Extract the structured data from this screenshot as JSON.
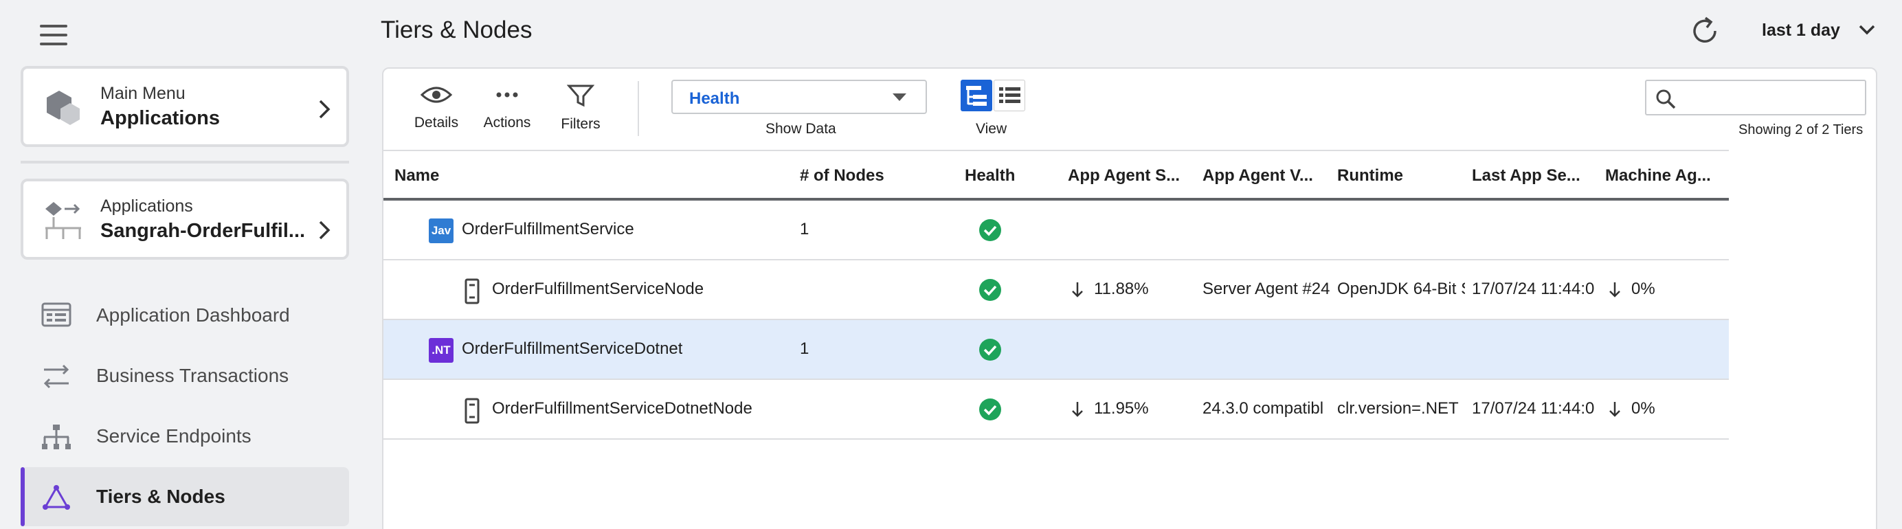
{
  "sidebar": {
    "main_menu": {
      "small": "Main Menu",
      "big": "Applications"
    },
    "application": {
      "small": "Applications",
      "big": "Sangrah-OrderFulfil..."
    },
    "nav": [
      {
        "label": "Application Dashboard",
        "icon": "dashboard-icon"
      },
      {
        "label": "Business Transactions",
        "icon": "transactions-icon"
      },
      {
        "label": "Service Endpoints",
        "icon": "endpoints-icon"
      },
      {
        "label": "Tiers & Nodes",
        "icon": "tiers-nodes-icon",
        "active": true
      }
    ]
  },
  "header": {
    "title": "Tiers & Nodes",
    "time_range": "last 1 day"
  },
  "toolbar": {
    "details": "Details",
    "actions": "Actions",
    "filters": "Filters",
    "show_data_value": "Health",
    "show_data_label": "Show Data",
    "view_label": "View",
    "search_placeholder": "",
    "showing": "Showing 2 of 2 Tiers"
  },
  "table": {
    "columns": [
      "Name",
      "# of Nodes",
      "Health",
      "App Agent S...",
      "App Agent V...",
      "Runtime",
      "Last App Se...",
      "Machine Ag..."
    ],
    "rows": [
      {
        "kind": "tier",
        "badge": "Jav",
        "name": "OrderFulfillmentService",
        "nodes": "1",
        "health": "ok",
        "agent_status": "",
        "agent_version": "",
        "runtime": "",
        "last_seen": "",
        "machine": ""
      },
      {
        "kind": "node",
        "name": "OrderFulfillmentServiceNode",
        "nodes": "",
        "health": "ok",
        "agent_status": "11.88%",
        "agent_version": "Server Agent #24",
        "runtime": "OpenJDK 64-Bit S",
        "last_seen": "17/07/24 11:44:0",
        "machine": "0%"
      },
      {
        "kind": "tier",
        "badge": ".NT",
        "name": "OrderFulfillmentServiceDotnet",
        "nodes": "1",
        "health": "ok",
        "agent_status": "",
        "agent_version": "",
        "runtime": "",
        "last_seen": "",
        "machine": "",
        "selected": true
      },
      {
        "kind": "node",
        "name": "OrderFulfillmentServiceDotnetNode",
        "nodes": "",
        "health": "ok",
        "agent_status": "11.95%",
        "agent_version": "24.3.0 compatibl",
        "runtime": "clr.version=.NET",
        "last_seen": "17/07/24 11:44:0",
        "machine": "0%"
      }
    ]
  },
  "colors": {
    "accent": "#1a63d6",
    "active_nav": "#6b3fd4",
    "health_ok": "#1ea45a",
    "selected_row": "#e1ecfb"
  }
}
